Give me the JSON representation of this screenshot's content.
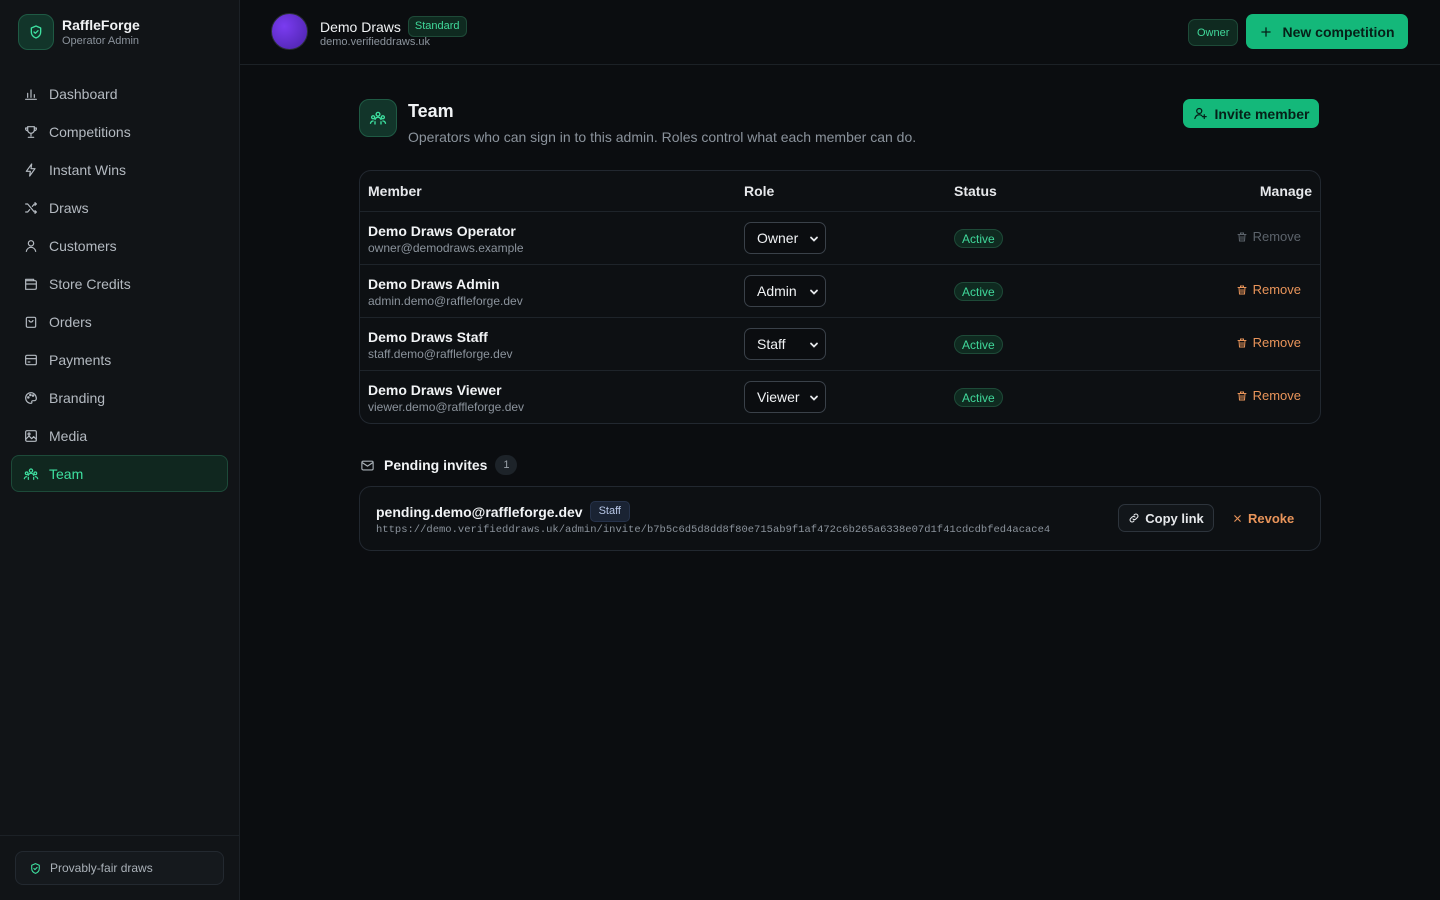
{
  "brand": {
    "name": "RaffleForge",
    "subtitle": "Operator Admin"
  },
  "sidebar": {
    "items": [
      {
        "label": "Dashboard",
        "icon": "bar-chart-icon"
      },
      {
        "label": "Competitions",
        "icon": "trophy-icon"
      },
      {
        "label": "Instant Wins",
        "icon": "bolt-icon"
      },
      {
        "label": "Draws",
        "icon": "shuffle-icon"
      },
      {
        "label": "Customers",
        "icon": "user-icon"
      },
      {
        "label": "Store Credits",
        "icon": "wallet-icon"
      },
      {
        "label": "Orders",
        "icon": "bag-icon"
      },
      {
        "label": "Payments",
        "icon": "credit-card-icon"
      },
      {
        "label": "Branding",
        "icon": "palette-icon"
      },
      {
        "label": "Media",
        "icon": "image-icon"
      },
      {
        "label": "Team",
        "icon": "users-icon",
        "active": true
      }
    ],
    "footer_badge": "Provably-fair draws"
  },
  "topbar": {
    "tenant_name": "Demo Draws",
    "tenant_plan": "Standard",
    "tenant_domain": "demo.verifieddraws.uk",
    "role": "Owner",
    "new_competition": "New competition"
  },
  "page": {
    "title": "Team",
    "subtitle": "Operators who can sign in to this admin. Roles control what each member can do.",
    "invite_button": "Invite member"
  },
  "members_table": {
    "headers": {
      "member": "Member",
      "role": "Role",
      "status": "Status",
      "manage": "Manage"
    },
    "rows": [
      {
        "name": "Demo Draws Operator",
        "email": "owner@demodraws.example",
        "role": "Owner",
        "status": "Active",
        "action": "Remove",
        "action_disabled": true
      },
      {
        "name": "Demo Draws Admin",
        "email": "admin.demo@raffleforge.dev",
        "role": "Admin",
        "status": "Active",
        "action": "Remove",
        "action_disabled": false
      },
      {
        "name": "Demo Draws Staff",
        "email": "staff.demo@raffleforge.dev",
        "role": "Staff",
        "status": "Active",
        "action": "Remove",
        "action_disabled": false
      },
      {
        "name": "Demo Draws Viewer",
        "email": "viewer.demo@raffleforge.dev",
        "role": "Viewer",
        "status": "Active",
        "action": "Remove",
        "action_disabled": false
      }
    ]
  },
  "pending": {
    "title": "Pending invites",
    "count": "1",
    "invites": [
      {
        "email": "pending.demo@raffleforge.dev",
        "role": "Staff",
        "link": "https://demo.verifieddraws.uk/admin/invite/b7b5c6d5d8dd8f80e715ab9f1af472c6b265a6338e07d1f41cdcdbfed4acace4",
        "copy_label": "Copy link",
        "revoke_label": "Revoke"
      }
    ]
  },
  "colors": {
    "accent": "#14b87a",
    "accent_text": "#40d89a",
    "danger": "#e8945a",
    "background": "#0b0d10"
  }
}
